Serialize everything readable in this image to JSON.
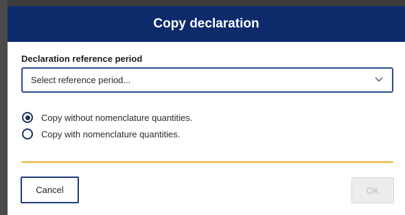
{
  "dialog": {
    "title": "Copy declaration",
    "field_label": "Declaration reference period",
    "select": {
      "placeholder": "Select reference period..."
    },
    "options": [
      {
        "label": "Copy without nomenclature quantities.",
        "selected": true
      },
      {
        "label": "Copy with nomenclature quantities.",
        "selected": false
      }
    ],
    "buttons": {
      "cancel": "Cancel",
      "ok": "OK"
    }
  },
  "colors": {
    "titlebar": "#0d2b6b",
    "accent_border": "#2b4a8e",
    "divider": "#f0b429",
    "disabled_button": "#ececec"
  },
  "icons": {
    "select_arrow": "chevron-down-icon"
  }
}
